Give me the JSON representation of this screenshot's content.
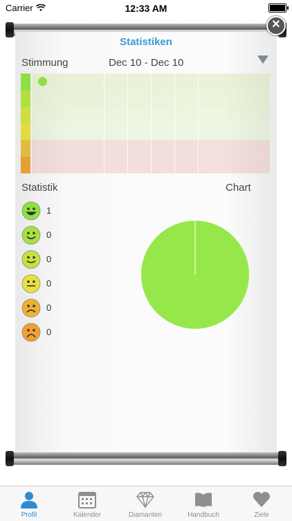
{
  "status_bar": {
    "carrier": "Carrier",
    "time": "12:33 AM"
  },
  "panel": {
    "title": "Statistiken"
  },
  "mood_section": {
    "label": "Stimmung",
    "date_range": "Dec 10 - Dec 10"
  },
  "mood_colors": [
    "#8fe040",
    "#b0e040",
    "#cbe040",
    "#e2dc40",
    "#e2bc40",
    "#e8a030"
  ],
  "stats": {
    "label": "Statistik",
    "chart_label": "Chart",
    "rows": [
      {
        "mood": "very-happy",
        "count": "1",
        "color": "#8fe040"
      },
      {
        "mood": "happy",
        "count": "0",
        "color": "#a8e040"
      },
      {
        "mood": "content",
        "count": "0",
        "color": "#c4e040"
      },
      {
        "mood": "neutral",
        "count": "0",
        "color": "#e8e040"
      },
      {
        "mood": "sad",
        "count": "0",
        "color": "#f0b030"
      },
      {
        "mood": "very-sad",
        "count": "0",
        "color": "#f0a030"
      }
    ]
  },
  "pie_chart": {
    "slices": [
      {
        "mood": "very-happy",
        "value": 1,
        "color": "#96e84a"
      }
    ]
  },
  "tabbar": {
    "items": [
      {
        "label": "Profil",
        "icon": "person-icon",
        "active": true
      },
      {
        "label": "Kalender",
        "icon": "calendar-icon",
        "active": false
      },
      {
        "label": "Diamanten",
        "icon": "diamond-icon",
        "active": false
      },
      {
        "label": "Handbuch",
        "icon": "book-icon",
        "active": false
      },
      {
        "label": "Ziele",
        "icon": "heart-icon",
        "active": false
      }
    ]
  }
}
